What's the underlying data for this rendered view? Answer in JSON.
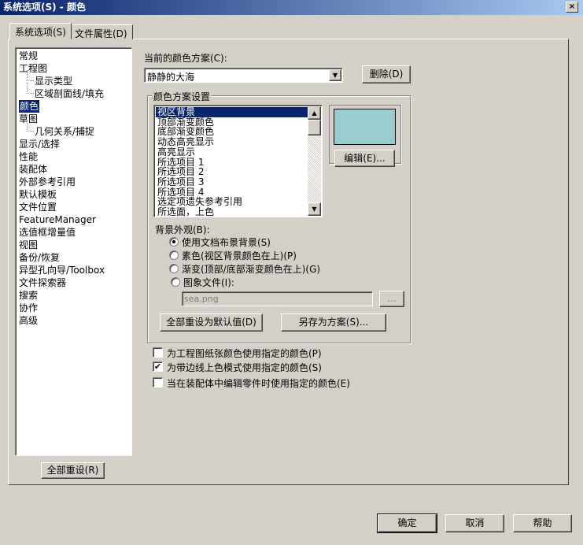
{
  "window": {
    "title": "系统选项(S) - 颜色",
    "close": "×"
  },
  "tabs": [
    {
      "label": "系统选项(S)"
    },
    {
      "label": "文件属性(D)"
    }
  ],
  "tree": [
    {
      "label": "常规",
      "indent": 0
    },
    {
      "label": "工程图",
      "indent": 0
    },
    {
      "label": "显示类型",
      "indent": 1
    },
    {
      "label": "区域剖面线/填充",
      "indent": 1
    },
    {
      "label": "颜色",
      "indent": 0,
      "selected": true
    },
    {
      "label": "草图",
      "indent": 0
    },
    {
      "label": "几何关系/捕捉",
      "indent": 1
    },
    {
      "label": "显示/选择",
      "indent": 0
    },
    {
      "label": "性能",
      "indent": 0
    },
    {
      "label": "装配体",
      "indent": 0
    },
    {
      "label": "外部参考引用",
      "indent": 0
    },
    {
      "label": "默认模板",
      "indent": 0
    },
    {
      "label": "文件位置",
      "indent": 0
    },
    {
      "label": "FeatureManager",
      "indent": 0
    },
    {
      "label": "选值框增量值",
      "indent": 0
    },
    {
      "label": "视图",
      "indent": 0
    },
    {
      "label": "备份/恢复",
      "indent": 0
    },
    {
      "label": "异型孔向导/Toolbox",
      "indent": 0
    },
    {
      "label": "文件探索器",
      "indent": 0
    },
    {
      "label": "搜索",
      "indent": 0
    },
    {
      "label": "协作",
      "indent": 0
    },
    {
      "label": "高级",
      "indent": 0
    }
  ],
  "reset_all": "全部重设(R)",
  "scheme": {
    "label": "当前的颜色方案(C):",
    "value": "静静的大海",
    "delete": "删除(D)"
  },
  "settings": {
    "legend": "颜色方案设置",
    "items": [
      "视区背景",
      "顶部渐变颜色",
      "底部渐变颜色",
      "动态高亮显示",
      "高亮显示",
      "所选项目 1",
      "所选项目 2",
      "所选项目 3",
      "所选项目 4",
      "选定项遗失参考引用",
      "所选面，上色"
    ],
    "preview_color": "#99CCCC",
    "edit": "编辑(E)...",
    "bg_label": "背景外观(B):",
    "radios": [
      {
        "label": "使用文档布景背景(S)",
        "checked": true
      },
      {
        "label": "素色(视区背景颜色在上)(P)",
        "checked": false
      },
      {
        "label": "渐变(顶部/底部渐变颜色在上)(G)",
        "checked": false
      },
      {
        "label": "图象文件(I):",
        "checked": false
      }
    ],
    "image_file": "sea.png",
    "browse": "...",
    "reset_defaults": "全部重设为默认值(D)",
    "save_as": "另存为方案(S)..."
  },
  "checks": [
    {
      "label": "为工程图纸张颜色使用指定的颜色(P)",
      "checked": false
    },
    {
      "label": "为带边线上色模式使用指定的颜色(S)",
      "checked": true
    },
    {
      "label": "当在装配体中编辑零件时使用指定的颜色(E)",
      "checked": false
    }
  ],
  "footer": {
    "ok": "确定",
    "cancel": "取消",
    "help": "帮助"
  }
}
